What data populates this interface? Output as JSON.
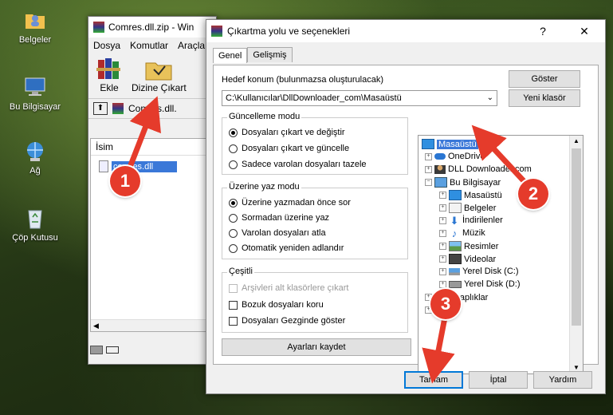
{
  "desktop": {
    "icons": [
      {
        "label": "Belgeler",
        "icon": "folder-user-icon"
      },
      {
        "label": "Bu Bilgisayar",
        "icon": "computer-icon"
      },
      {
        "label": "Ağ",
        "icon": "network-icon"
      },
      {
        "label": "Çöp Kutusu",
        "icon": "recycle-bin-icon"
      }
    ]
  },
  "archive_window": {
    "title": "Comres.dll.zip - Win",
    "menu": [
      "Dosya",
      "Komutlar",
      "Araçla"
    ],
    "tools": [
      "Ekle",
      "Dizine Çıkart"
    ],
    "path": "Comres.dll.",
    "column_header": "İsim",
    "file_name": "comres.dll"
  },
  "dialog": {
    "title": "Çıkartma yolu ve seçenekleri",
    "help_glyph": "?",
    "close_glyph": "✕",
    "tabs": [
      "Genel",
      "Gelişmiş"
    ],
    "dest_label": "Hedef konum (bulunmazsa oluşturulacak)",
    "dest_value": "C:\\Kullanıcılar\\DllDownloader_com\\Masaüstü",
    "show_button": "Göster",
    "new_folder_button": "Yeni klasör",
    "update_group": {
      "title": "Güncelleme modu",
      "options": [
        "Dosyaları çıkart ve değiştir",
        "Dosyaları çıkart ve güncelle",
        "Sadece varolan dosyaları tazele"
      ],
      "selected": 0
    },
    "overwrite_group": {
      "title": "Üzerine yaz modu",
      "options": [
        "Üzerine yazmadan önce sor",
        "Sormadan üzerine yaz",
        "Varolan dosyaları atla",
        "Otomatik yeniden adlandır"
      ],
      "selected": 0
    },
    "misc_group": {
      "title": "Çeşitli",
      "options": [
        "Arşivleri alt klasörlere çıkart",
        "Bozuk dosyaları koru",
        "Dosyaları Gezginde göster"
      ],
      "disabled": [
        true,
        false,
        false
      ]
    },
    "save_settings_button": "Ayarları kaydet",
    "tree": [
      {
        "label": "Masaüstü",
        "icon": "desktop-icon",
        "selected": true
      },
      {
        "label": "OneDrive",
        "icon": "cloud-icon"
      },
      {
        "label": "DLL Downloader.com",
        "icon": "user-icon"
      },
      {
        "label": "Bu Bilgisayar",
        "icon": "computer-icon"
      },
      {
        "label": "Masaüstü",
        "icon": "desktop-icon"
      },
      {
        "label": "Belgeler",
        "icon": "documents-icon"
      },
      {
        "label": "İndirilenler",
        "icon": "download-icon"
      },
      {
        "label": "Müzik",
        "icon": "music-icon"
      },
      {
        "label": "Resimler",
        "icon": "pictures-icon"
      },
      {
        "label": "Videolar",
        "icon": "video-icon"
      },
      {
        "label": "Yerel Disk (C:)",
        "icon": "drive-icon"
      },
      {
        "label": "Yerel Disk (D:)",
        "icon": "drive-icon"
      },
      {
        "label": "Kitaplıklar",
        "icon": "library-icon"
      },
      {
        "label": "Ağ",
        "icon": "network-icon"
      }
    ],
    "ok_button": "Tamam",
    "cancel_button": "İptal",
    "help_button": "Yardım"
  },
  "step_badges": [
    "1",
    "2",
    "3"
  ],
  "colors": {
    "badge": "#e53b2b",
    "selection": "#3a78d8",
    "accent": "#0078d7"
  }
}
